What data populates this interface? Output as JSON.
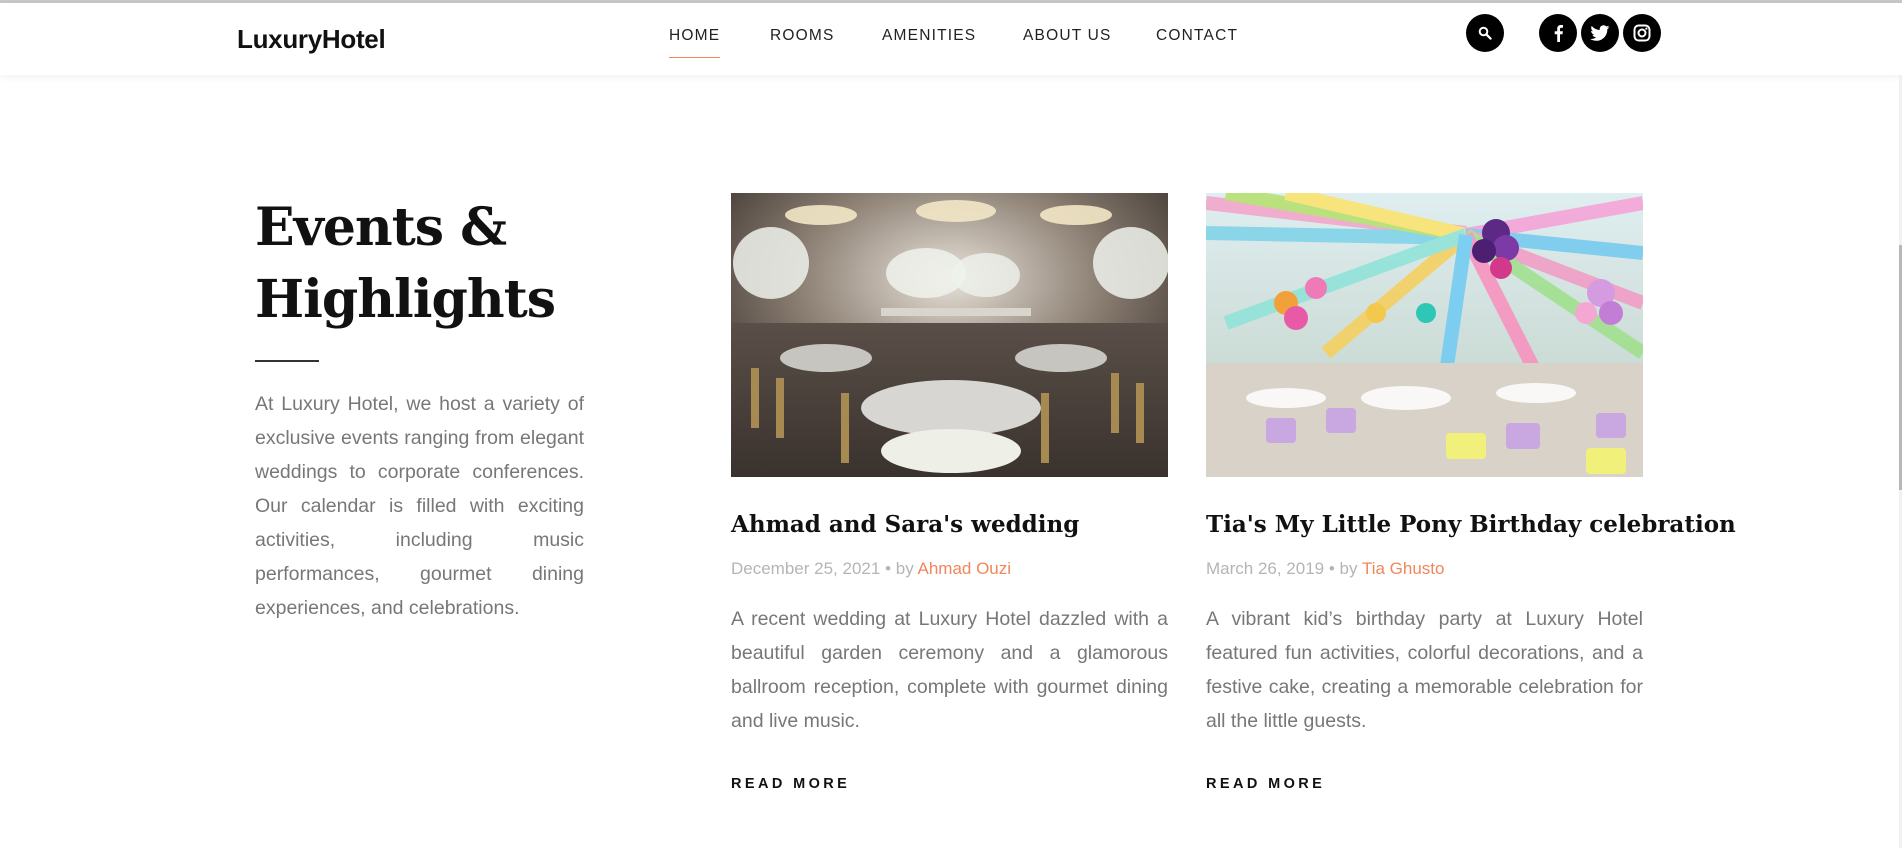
{
  "header": {
    "brand": "LuxuryHotel",
    "nav": [
      {
        "label": "HOME",
        "active": true
      },
      {
        "label": "ROOMS",
        "active": false
      },
      {
        "label": "AMENITIES",
        "active": false
      },
      {
        "label": "ABOUT US",
        "active": false
      },
      {
        "label": "CONTACT",
        "active": false
      }
    ],
    "icons": [
      "search-icon",
      "facebook-icon",
      "twitter-icon",
      "instagram-icon"
    ]
  },
  "intro": {
    "title": "Events & Highlights",
    "text": "At Luxury Hotel, we host a variety of exclusive events ranging from elegant weddings to corporate conferences. Our calendar is filled with exciting activities, including music performances, gourmet dining experiences, and celebrations."
  },
  "events": [
    {
      "title": "Ahmad and Sara's wedding",
      "date": "December 25, 2021",
      "by": "• by",
      "author": "Ahmad Ouzi",
      "text": "A recent wedding at Luxury Hotel dazzled with a beautiful garden ceremony and a glamorous ballroom reception, complete with gourmet dining and live music.",
      "cta": "READ MORE"
    },
    {
      "title": "Tia's My Little Pony Birthday celebration",
      "date": "March 26, 2019",
      "by": "• by",
      "author": "Tia Ghusto",
      "text": "A vibrant kid’s birthday party at Luxury Hotel featured fun activities, colorful decorations, and a festive cake, creating a memorable celebration for all the little guests.",
      "cta": "READ MORE"
    }
  ],
  "colors": {
    "accent": "#f0875a",
    "text_muted": "#777777",
    "meta": "#b5b5b5",
    "dark": "#111111"
  }
}
